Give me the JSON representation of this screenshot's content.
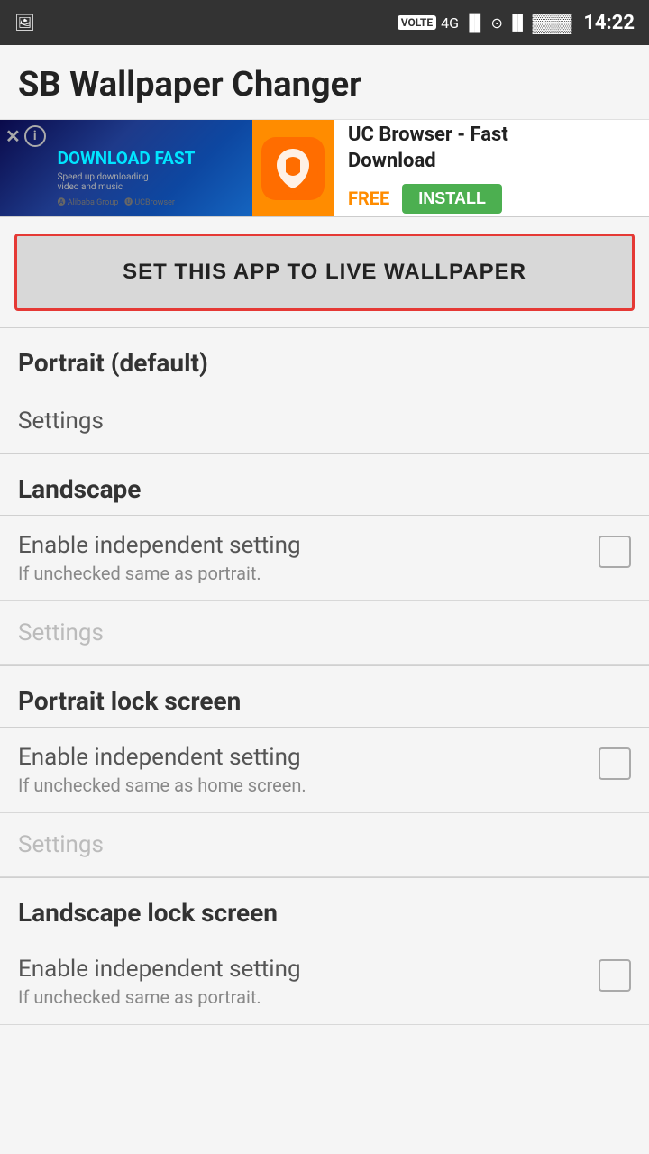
{
  "status_bar": {
    "time": "14:22",
    "volte": "VOLTE",
    "network": "4G"
  },
  "header": {
    "title": "SB Wallpaper Changer"
  },
  "ad": {
    "app_name": "UC Browser - Fast\nDownload",
    "free_label": "FREE",
    "install_label": "INSTALL",
    "close_label": "✕",
    "info_label": "i"
  },
  "main": {
    "set_wallpaper_btn": "SET THIS APP TO LIVE WALLPAPER",
    "portrait_section": {
      "title": "Portrait (default)",
      "settings_label": "Settings"
    },
    "landscape_section": {
      "title": "Landscape",
      "enable_label": "Enable independent setting",
      "enable_subtitle": "If unchecked same as portrait.",
      "settings_label": "Settings"
    },
    "portrait_lock_section": {
      "title": "Portrait lock screen",
      "enable_label": "Enable independent setting",
      "enable_subtitle": "If unchecked same as home screen.",
      "settings_label": "Settings"
    },
    "landscape_lock_section": {
      "title": "Landscape lock screen",
      "enable_label": "Enable independent setting",
      "enable_subtitle": "If unchecked same as portrait."
    }
  }
}
